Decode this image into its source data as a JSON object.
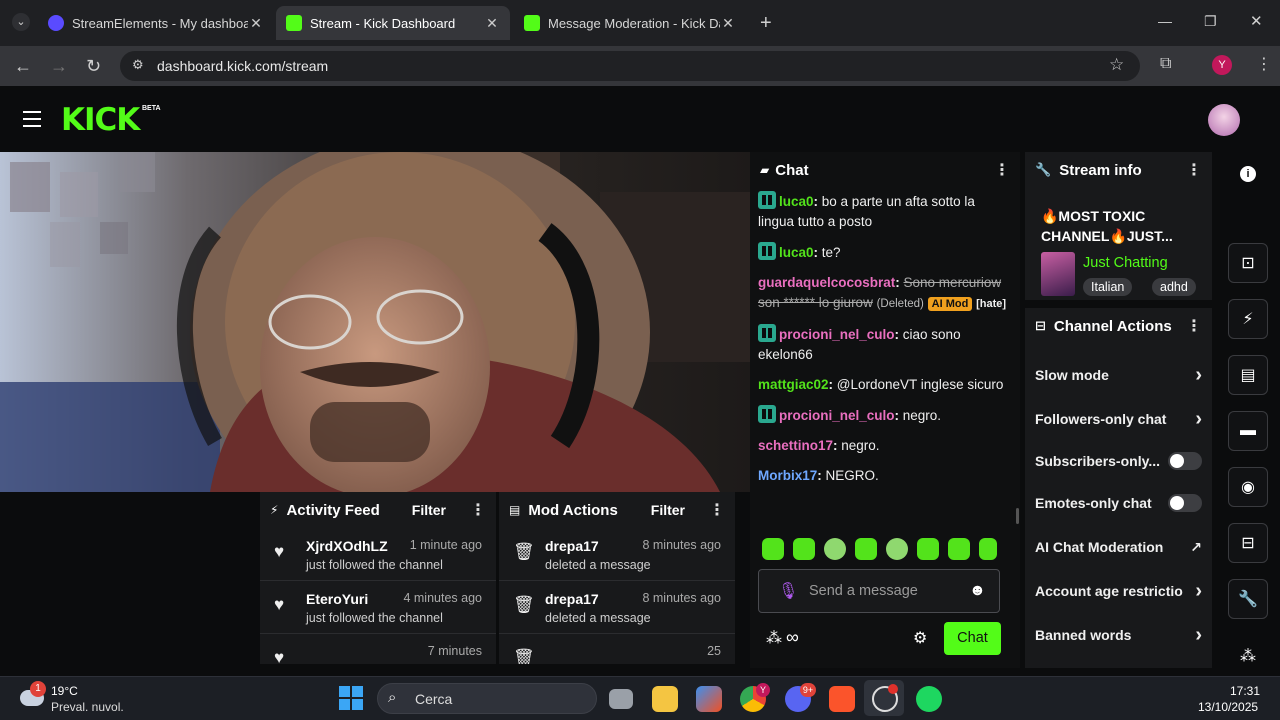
{
  "browser": {
    "tabs": [
      {
        "title": "StreamElements - My dashboard",
        "favicon_color": "#5a4bff"
      },
      {
        "title": "Stream - Kick Dashboard",
        "favicon_color": "#53fc18"
      },
      {
        "title": "Message Moderation - Kick Dashboard",
        "favicon_color": "#53fc18"
      }
    ],
    "url": "dashboard.kick.com/stream",
    "profile_initial": "Y"
  },
  "header": {
    "logo": "KICK",
    "logo_badge": "BETA"
  },
  "chat": {
    "title": "Chat",
    "messages": [
      {
        "user": "luca0",
        "text": "bo a parte un afta sotto la lingua tutto a posto",
        "color": "#53e31b",
        "badge": true
      },
      {
        "user": "luca0",
        "text": "te?",
        "color": "#53e31b",
        "badge": true
      },
      {
        "user": "guardaquelcocosbrat",
        "text": "Sono mercuriow son ****** lo giurow",
        "color": "#e96fbf",
        "badge": false,
        "deleted": true,
        "deleted_label": "(Deleted)",
        "mod_label": "AI Mod",
        "reason": "[hate]"
      },
      {
        "user": "procioni_nel_culo",
        "text": "ciao sono ekelon66",
        "color": "#e96fbf",
        "badge": true
      },
      {
        "user": "mattgiac02",
        "text": "@LordoneVT inglese sicuro",
        "color": "#53e31b",
        "badge": false
      },
      {
        "user": "procioni_nel_culo",
        "text": "negro.",
        "color": "#e96fbf",
        "badge": true
      },
      {
        "user": "schettino17",
        "text": "negro.",
        "color": "#e96fbf",
        "badge": false
      },
      {
        "user": "Morbix17",
        "text": "NEGRO.",
        "color": "#6fa8ff",
        "badge": false
      }
    ],
    "input_placeholder": "Send a message",
    "send_label": "Chat"
  },
  "activity_feed": {
    "title": "Activity Feed",
    "filter": "Filter",
    "items": [
      {
        "name": "XjrdXOdhLZ",
        "time": "1 minute ago",
        "action": "just followed the channel"
      },
      {
        "name": "EteroYuri",
        "time": "4 minutes ago",
        "action": "just followed the channel"
      },
      {
        "name": "",
        "time": "7 minutes",
        "action": ""
      }
    ]
  },
  "mod_actions": {
    "title": "Mod Actions",
    "filter": "Filter",
    "items": [
      {
        "name": "drepa17",
        "time": "8 minutes ago",
        "action": "deleted a message"
      },
      {
        "name": "drepa17",
        "time": "8 minutes ago",
        "action": "deleted a message"
      },
      {
        "name": "",
        "time": "25",
        "action": ""
      }
    ]
  },
  "stream_info": {
    "title": "Stream info",
    "stream_title": "🔥MOST TOXIC CHANNEL🔥JUST...",
    "category": "Just Chatting",
    "tags": [
      "Italian",
      "adhd"
    ]
  },
  "channel_actions": {
    "title": "Channel Actions",
    "items": [
      {
        "label": "Slow mode",
        "control": "chevron"
      },
      {
        "label": "Followers-only chat",
        "control": "chevron"
      },
      {
        "label": "Subscribers-only...",
        "control": "toggle"
      },
      {
        "label": "Emotes-only chat",
        "control": "toggle"
      },
      {
        "label": "AI Chat Moderation",
        "control": "external"
      },
      {
        "label": "Account age restrictio",
        "control": "chevron"
      },
      {
        "label": "Banned words",
        "control": "chevron"
      }
    ]
  },
  "taskbar": {
    "weather_temp": "19°C",
    "weather_desc": "Preval. nuvol.",
    "weather_badge": "1",
    "search_placeholder": "Cerca",
    "time": "17:31",
    "date": "13/10/2025",
    "discord_badge": "9+",
    "chrome_badge": "Y"
  },
  "colors": {
    "kick_green": "#53fc18",
    "panel_bg": "#18191b",
    "page_bg": "#0b0c0d"
  }
}
